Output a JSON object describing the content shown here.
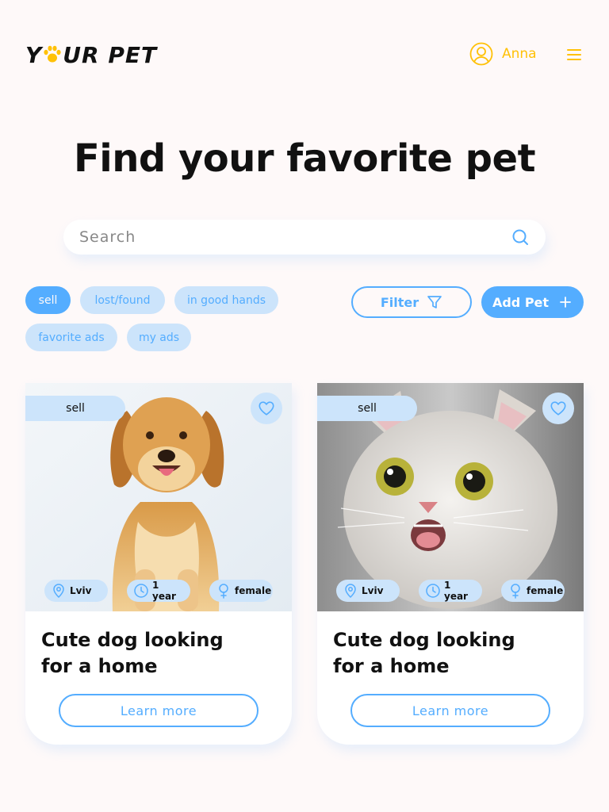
{
  "header": {
    "logo_part1": "Y",
    "logo_part2": "UR PET",
    "logo_paw_color": "#FFC107",
    "user_name": "Anna",
    "user_icon": "user-circle-icon",
    "menu_icon": "hamburger-menu-icon"
  },
  "hero": {
    "title": "Find your favorite pet"
  },
  "search": {
    "placeholder": "Search",
    "value": "",
    "icon": "search-icon"
  },
  "categories": [
    {
      "label": "sell",
      "active": true
    },
    {
      "label": "lost/found",
      "active": false
    },
    {
      "label": "in good hands",
      "active": false
    },
    {
      "label": "favorite ads",
      "active": false
    },
    {
      "label": "my ads",
      "active": false
    }
  ],
  "actions": {
    "filter_label": "Filter",
    "filter_icon": "filter-icon",
    "add_label": "Add Pet",
    "add_icon": "plus-icon"
  },
  "cards": [
    {
      "image": "golden-retriever-dog-photo",
      "category": "sell",
      "location": "Lviv",
      "age": "1 year",
      "sex": "female",
      "title": "Cute dog looking for a home",
      "button": "Learn more"
    },
    {
      "image": "white-cat-photo",
      "category": "sell",
      "location": "Lviv",
      "age": "1 year",
      "sex": "female",
      "title": "Cute dog looking for a home",
      "button": "Learn more"
    }
  ],
  "colors": {
    "background": "#FEF9F9",
    "accent_blue": "#54ADFF",
    "light_blue": "#CCE4FB",
    "accent_yellow": "#FFC107",
    "text": "#111111"
  }
}
